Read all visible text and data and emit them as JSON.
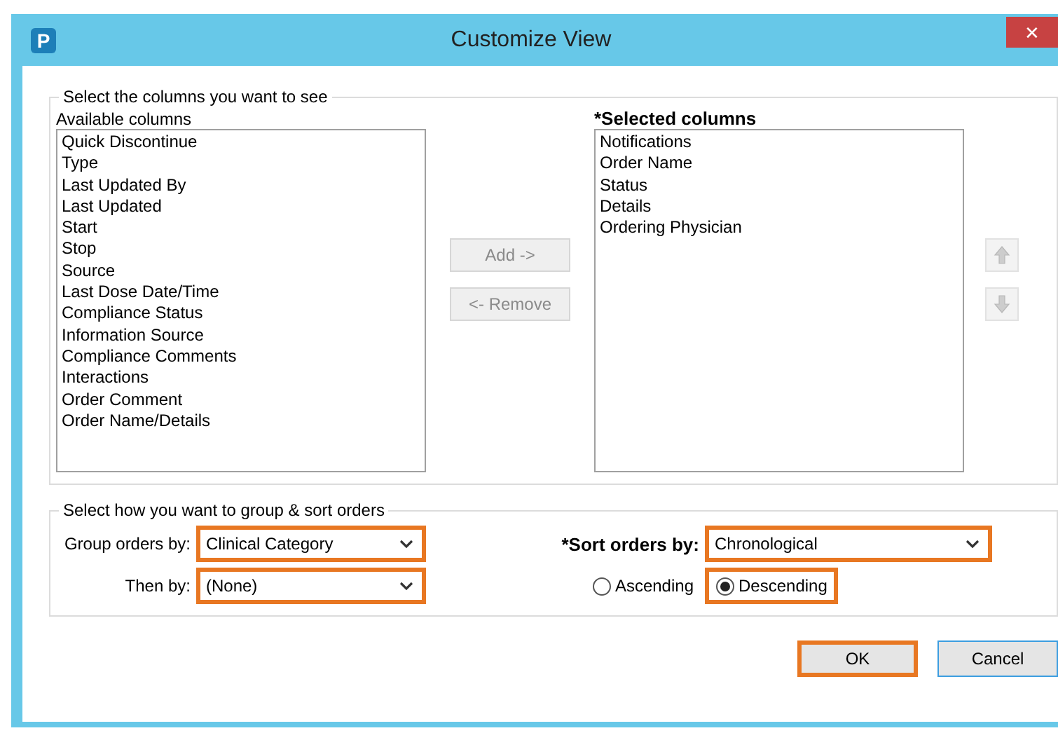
{
  "window": {
    "title": "Customize View",
    "app_icon": "P",
    "close": "✕"
  },
  "columns_group": {
    "legend": "Select the columns you want to see",
    "available": {
      "label": "Available columns",
      "items": [
        "Quick Discontinue",
        "Type",
        "Last Updated By",
        "Last Updated",
        "Start",
        "Stop",
        "Source",
        "Last Dose Date/Time",
        "Compliance Status",
        "Information Source",
        "Compliance Comments",
        "Interactions",
        "Order Comment",
        "Order Name/Details"
      ]
    },
    "selected": {
      "label": "*Selected columns",
      "items": [
        "Notifications",
        "Order Name",
        "Status",
        "Details",
        "Ordering Physician"
      ]
    },
    "add_button": {
      "label": "Add ->",
      "disabled": true
    },
    "remove_button": {
      "label": "<- Remove",
      "disabled": true
    },
    "move_up": {
      "disabled": true
    },
    "move_down": {
      "disabled": true
    }
  },
  "sort_group": {
    "legend": "Select how you want to group & sort orders",
    "group_by": {
      "label": "Group orders by:",
      "value": "Clinical Category",
      "highlighted": true
    },
    "then_by": {
      "label": "Then by:",
      "value": "(None)",
      "highlighted": true
    },
    "sort_by": {
      "label": "*Sort orders by:",
      "value": "Chronological",
      "highlighted": true
    },
    "order": [
      {
        "label": "Ascending",
        "selected": false,
        "highlighted": false
      },
      {
        "label": "Descending",
        "selected": true,
        "highlighted": true
      }
    ]
  },
  "buttons": [
    {
      "label": "OK",
      "highlighted": true
    },
    {
      "label": "Cancel",
      "highlighted": false
    }
  ]
}
